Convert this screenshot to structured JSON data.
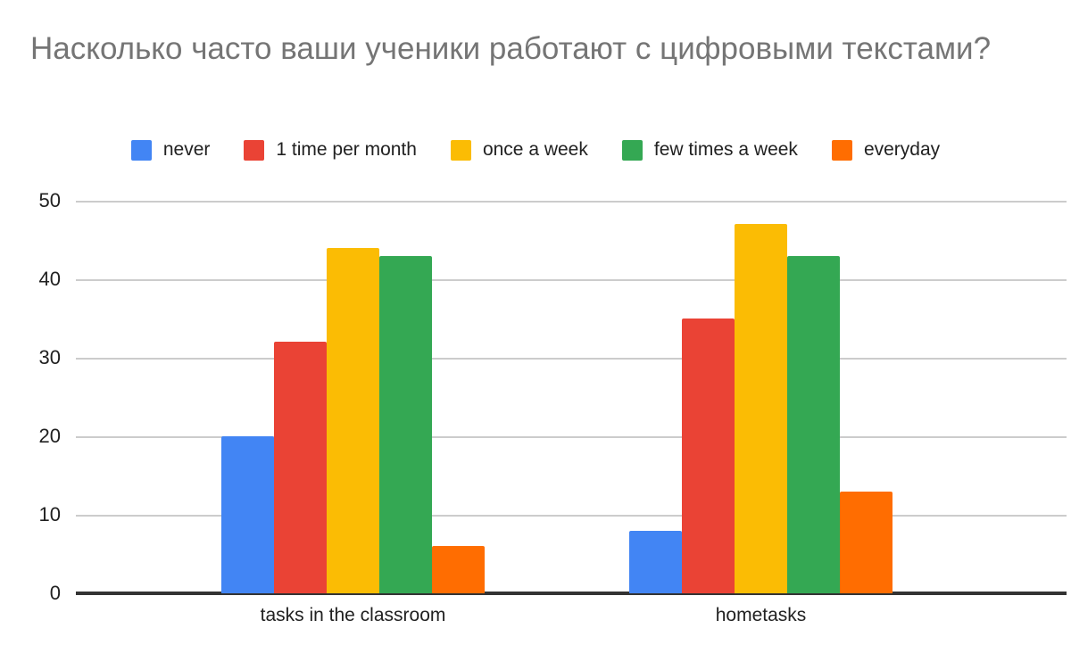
{
  "chart_data": {
    "type": "bar",
    "title": "Насколько часто ваши ученики работают с цифровыми текстами?",
    "xlabel": "",
    "ylabel": "",
    "categories": [
      "tasks in the classroom",
      "hometasks"
    ],
    "series": [
      {
        "name": "never",
        "color": "#4285F4",
        "values": [
          20,
          8
        ]
      },
      {
        "name": "1 time per month",
        "color": "#EA4335",
        "values": [
          32,
          35
        ]
      },
      {
        "name": "once a week",
        "color": "#FBBC04",
        "values": [
          44,
          47
        ]
      },
      {
        "name": "few times a week",
        "color": "#34A853",
        "values": [
          43,
          43
        ]
      },
      {
        "name": "everyday",
        "color": "#FF6D01",
        "values": [
          6,
          13
        ]
      }
    ],
    "ylim": [
      0,
      50
    ],
    "yticks": [
      0,
      10,
      20,
      30,
      40,
      50
    ],
    "ytick_labels": [
      "0",
      "10",
      "20",
      "30",
      "40",
      "50"
    ],
    "grid": true,
    "grid_color": "#cccccc",
    "axis_color": "#333333",
    "legend_position": "top",
    "title_color": "#757575",
    "label_color": "#212121",
    "background": "#ffffff"
  }
}
